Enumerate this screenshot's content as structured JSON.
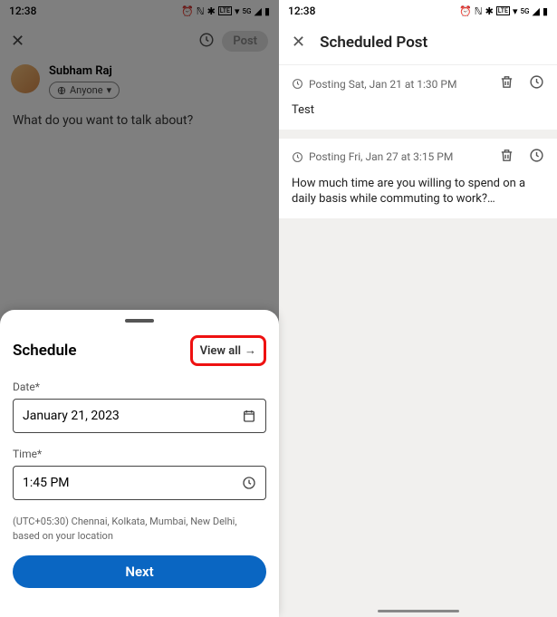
{
  "statusbar": {
    "time": "12:38"
  },
  "left": {
    "composer": {
      "post_button": "Post",
      "user_name": "Subham Raj",
      "audience": "Anyone",
      "prompt": "What do you want to talk about?"
    },
    "sheet": {
      "title": "Schedule",
      "view_all": "View all",
      "date_label": "Date*",
      "date_value": "January 21, 2023",
      "time_label": "Time*",
      "time_value": "1:45 PM",
      "tz_note": "(UTC+05:30) Chennai, Kolkata, Mumbai, New Delhi, based on your location",
      "next": "Next"
    }
  },
  "right": {
    "title": "Scheduled Post",
    "items": [
      {
        "meta": "Posting Sat, Jan 21 at 1:30 PM",
        "body": "Test"
      },
      {
        "meta": "Posting Fri, Jan 27 at 3:15 PM",
        "body": "How much time are you willing to spend on a daily basis while commuting to work?…"
      }
    ]
  }
}
